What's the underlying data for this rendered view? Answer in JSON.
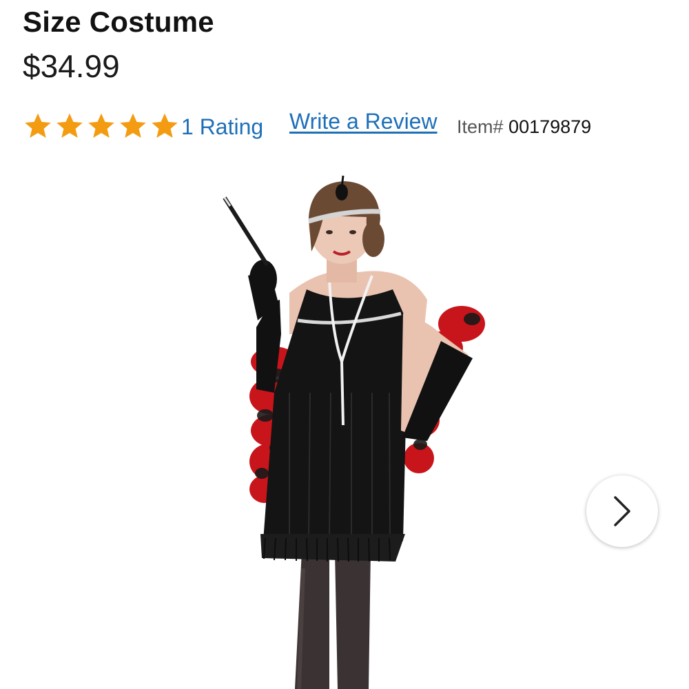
{
  "product": {
    "title": "Size Costume",
    "price": "$34.99"
  },
  "rating": {
    "stars": 5,
    "star_color": "#f39c12",
    "count_label": "1 Rating",
    "write_review_label": "Write a Review",
    "item_label": "Item#",
    "item_number": "00179879"
  },
  "gallery": {
    "next_icon": "chevron-right-icon"
  },
  "colors": {
    "link": "#1d6fb8",
    "text": "#111111"
  }
}
